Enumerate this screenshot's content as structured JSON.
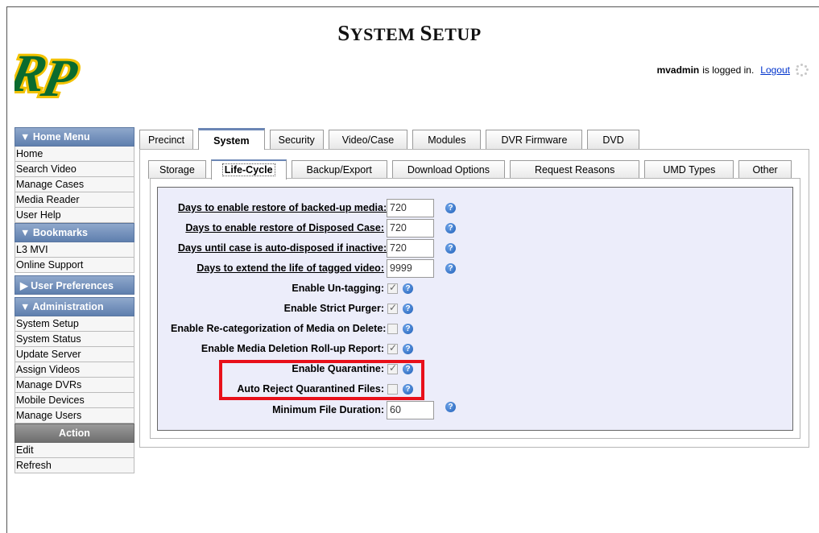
{
  "page_title_first": "S",
  "page_title_rest1": "YSTEM ",
  "page_title_second": "S",
  "page_title_rest2": "ETUP",
  "user": {
    "username": "mvadmin",
    "logged_in_text": "is logged in.",
    "logout_label": "Logout"
  },
  "logo": {
    "letters": "RP",
    "color": "#0a6b2e",
    "accent": "#f2c200"
  },
  "sidebar": {
    "home_menu": {
      "title": "▼ Home Menu",
      "items": [
        "Home",
        "Search Video",
        "Manage Cases",
        "Media Reader",
        "User Help"
      ]
    },
    "bookmarks": {
      "title": "▼ Bookmarks",
      "items": [
        "L3 MVI",
        "Online Support"
      ]
    },
    "user_preferences": {
      "title": "▶ User Preferences"
    },
    "administration": {
      "title": "▼ Administration",
      "items": [
        "System Setup",
        "System Status",
        "Update Server",
        "Assign Videos",
        "Manage DVRs",
        "Mobile Devices",
        "Manage Users"
      ]
    },
    "action": {
      "title": "Action",
      "items": [
        "Edit",
        "Refresh"
      ]
    }
  },
  "tabs": [
    "Precinct",
    "System",
    "Security",
    "Video/Case",
    "Modules",
    "DVR Firmware",
    "DVD"
  ],
  "active_tab": "System",
  "subtabs": [
    "Storage",
    "Life-Cycle",
    "Backup/Export",
    "Download Options",
    "Request Reasons",
    "UMD Types",
    "Other"
  ],
  "active_subtab": "Life-Cycle",
  "settings": {
    "restore_backed_up": {
      "label": "Days to enable restore of backed-up media:",
      "value": "720"
    },
    "restore_disposed": {
      "label": "Days to enable restore of Disposed Case:",
      "value": "720"
    },
    "auto_disposed": {
      "label": "Days until case is auto-disposed if inactive:",
      "value": "720"
    },
    "extend_tagged": {
      "label": "Days to extend the life of tagged video:",
      "value": "9999"
    },
    "untagging": {
      "label": "Enable Un-tagging:",
      "checked": true
    },
    "strict_purger": {
      "label": "Enable Strict Purger:",
      "checked": true
    },
    "recategorization": {
      "label": "Enable Re-categorization of Media on Delete:",
      "checked": false
    },
    "rollup_report": {
      "label": "Enable Media Deletion Roll-up Report:",
      "checked": true
    },
    "quarantine": {
      "label": "Enable Quarantine:",
      "checked": true
    },
    "auto_reject": {
      "label": "Auto Reject Quarantined Files:",
      "checked": false
    },
    "min_duration": {
      "label": "Minimum File Duration:",
      "value": "60"
    }
  },
  "help_icon_glyph": "?",
  "colors": {
    "menu_header": "#6f8cb8",
    "action_header": "#808080",
    "form_background": "#ecedfa",
    "highlight_box": "#e8101a",
    "link": "#0033cc"
  }
}
